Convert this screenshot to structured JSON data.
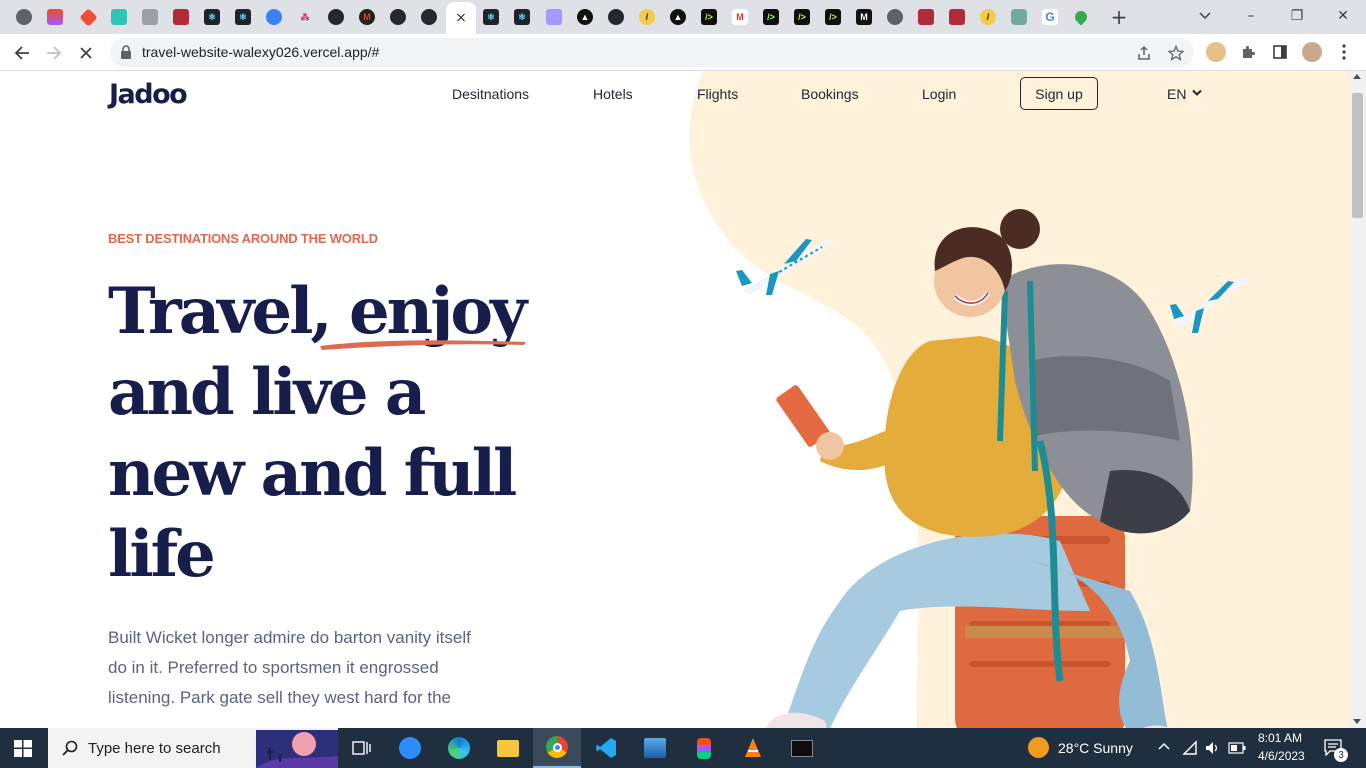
{
  "browser": {
    "active_tab_close": "×",
    "new_tab": "+",
    "url": "travel-website-walexy026.vercel.app/#",
    "window_controls": {
      "minimize": "–",
      "restore": "❐",
      "close": "✕"
    }
  },
  "site": {
    "logo": "Jadoo",
    "nav": {
      "destinations": "Desitnations",
      "hotels": "Hotels",
      "flights": "Flights",
      "bookings": "Bookings",
      "login": "Login",
      "signup": "Sign up",
      "lang": "EN"
    },
    "hero": {
      "eyebrow": "BEST DESTINATIONS AROUND THE WORLD",
      "headline_word1": "Travel,",
      "headline_word2": "enjoy",
      "headline_rest": "and live a new and full life",
      "paragraph": "Built Wicket longer admire do barton vanity itself do in it. Preferred to sportsmen it engrossed listening. Park gate sell they west hard for the"
    },
    "colors": {
      "brand_dark": "#181e4b",
      "accent_orange": "#df6951",
      "blob": "#fff1da",
      "plane_blue": "#1a96c2"
    }
  },
  "taskbar": {
    "search_placeholder": "Type here to search",
    "weather": "28°C  Sunny",
    "time": "8:01 AM",
    "date": "4/6/2023",
    "notifications": "3"
  }
}
